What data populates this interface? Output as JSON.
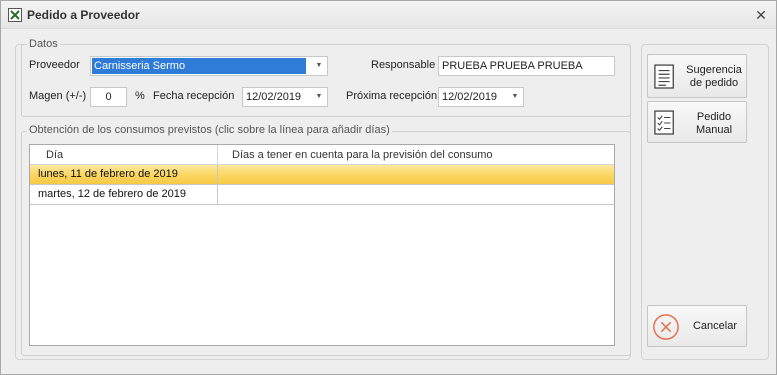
{
  "window": {
    "title": "Pedido a Proveedor",
    "close_glyph": "✕"
  },
  "datos": {
    "group_label": "Datos",
    "proveedor_label": "Proveedor",
    "proveedor_value": "Carnisseria Sermo",
    "responsable_label": "Responsable",
    "responsable_value": "PRUEBA PRUEBA PRUEBA",
    "margen_label": "Magen (+/-)",
    "margen_value": "0",
    "percent_sign": "%",
    "fecha_recepcion_label": "Fecha recepción",
    "fecha_recepcion_value": "12/02/2019",
    "proxima_recepcion_label": "Próxima recepción",
    "proxima_recepcion_value": "12/02/2019"
  },
  "consumos": {
    "group_label": "Obtención de los consumos previstos (clic sobre la línea para añadir días)",
    "columns": [
      "Día",
      "Días a tener en cuenta para la previsión del consumo"
    ],
    "rows": [
      {
        "dia": "lunes, 11 de febrero de 2019",
        "dias": "",
        "selected": true
      },
      {
        "dia": "martes, 12 de febrero de 2019",
        "dias": "",
        "selected": false
      }
    ]
  },
  "actions": {
    "sugerencia_line1": "Sugerencia",
    "sugerencia_line2": "de pedido",
    "manual_line1": "Pedido",
    "manual_line2": "Manual",
    "cancelar": "Cancelar"
  },
  "colors": {
    "selection_blue": "#2f7bd8",
    "row_highlight": "#fbd55f",
    "cancel_icon": "#e8704f"
  },
  "icons": [
    "app-icon",
    "close-icon",
    "chevron-down-icon",
    "document-list-icon",
    "document-check-icon",
    "cancel-circle-icon"
  ]
}
